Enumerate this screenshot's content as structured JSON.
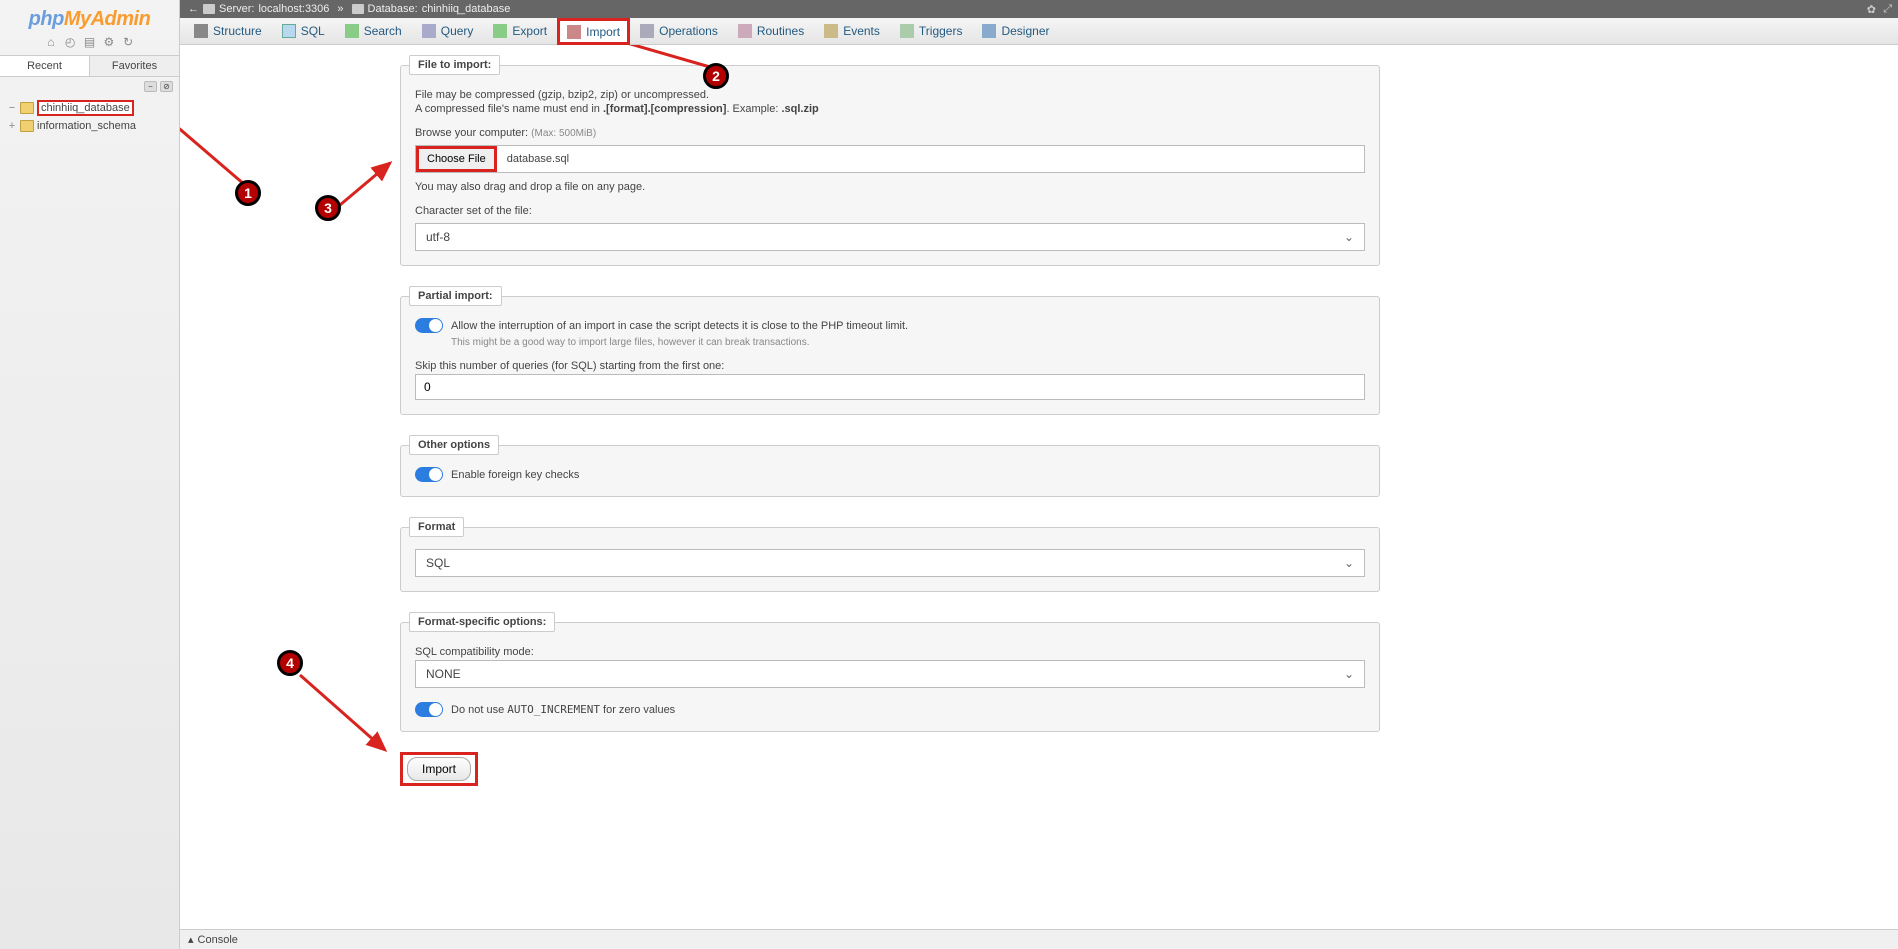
{
  "logo": {
    "p1": "php",
    "p2": "MyAdmin",
    "p3": ""
  },
  "sidebar_tabs": {
    "recent": "Recent",
    "favorites": "Favorites"
  },
  "tree": {
    "items": [
      {
        "label": "chinhiiq_database",
        "highlighted": true
      },
      {
        "label": "information_schema",
        "highlighted": false
      }
    ]
  },
  "breadcrumb": {
    "server_label": "Server:",
    "server_value": "localhost:3306",
    "db_label": "Database:",
    "db_value": "chinhiiq_database"
  },
  "tabs": [
    {
      "label": "Structure",
      "icon": "structure"
    },
    {
      "label": "SQL",
      "icon": "sql"
    },
    {
      "label": "Search",
      "icon": "search"
    },
    {
      "label": "Query",
      "icon": "query"
    },
    {
      "label": "Export",
      "icon": "export"
    },
    {
      "label": "Import",
      "icon": "import",
      "active": true,
      "highlighted": true
    },
    {
      "label": "Operations",
      "icon": "operations"
    },
    {
      "label": "Routines",
      "icon": "routines"
    },
    {
      "label": "Events",
      "icon": "events"
    },
    {
      "label": "Triggers",
      "icon": "triggers"
    },
    {
      "label": "Designer",
      "icon": "designer"
    }
  ],
  "file_import": {
    "legend": "File to import:",
    "hint1": "File may be compressed (gzip, bzip2, zip) or uncompressed.",
    "hint2a": "A compressed file's name must end in ",
    "hint2b": ".[format].[compression]",
    "hint2c": ". Example: ",
    "hint2d": ".sql.zip",
    "browse_label": "Browse your computer:",
    "browse_max": "(Max: 500MiB)",
    "choose_btn": "Choose File",
    "file_name": "database.sql",
    "drag_hint": "You may also drag and drop a file on any page.",
    "charset_label": "Character set of the file:",
    "charset_value": "utf-8"
  },
  "partial": {
    "legend": "Partial import:",
    "toggle_label": "Allow the interruption of an import in case the script detects it is close to the PHP timeout limit.",
    "sub_hint": "This might be a good way to import large files, however it can break transactions.",
    "skip_label": "Skip this number of queries (for SQL) starting from the first one:",
    "skip_value": "0"
  },
  "other": {
    "legend": "Other options",
    "fk_label": "Enable foreign key checks"
  },
  "format": {
    "legend": "Format",
    "value": "SQL"
  },
  "format_opts": {
    "legend": "Format-specific options:",
    "compat_label": "SQL compatibility mode:",
    "compat_value": "NONE",
    "auto_inc_a": "Do not use ",
    "auto_inc_b": "AUTO_INCREMENT",
    "auto_inc_c": " for zero values"
  },
  "submit": {
    "label": "Import"
  },
  "console": {
    "label": "Console"
  },
  "badges": {
    "b1": "1",
    "b2": "2",
    "b3": "3",
    "b4": "4"
  }
}
